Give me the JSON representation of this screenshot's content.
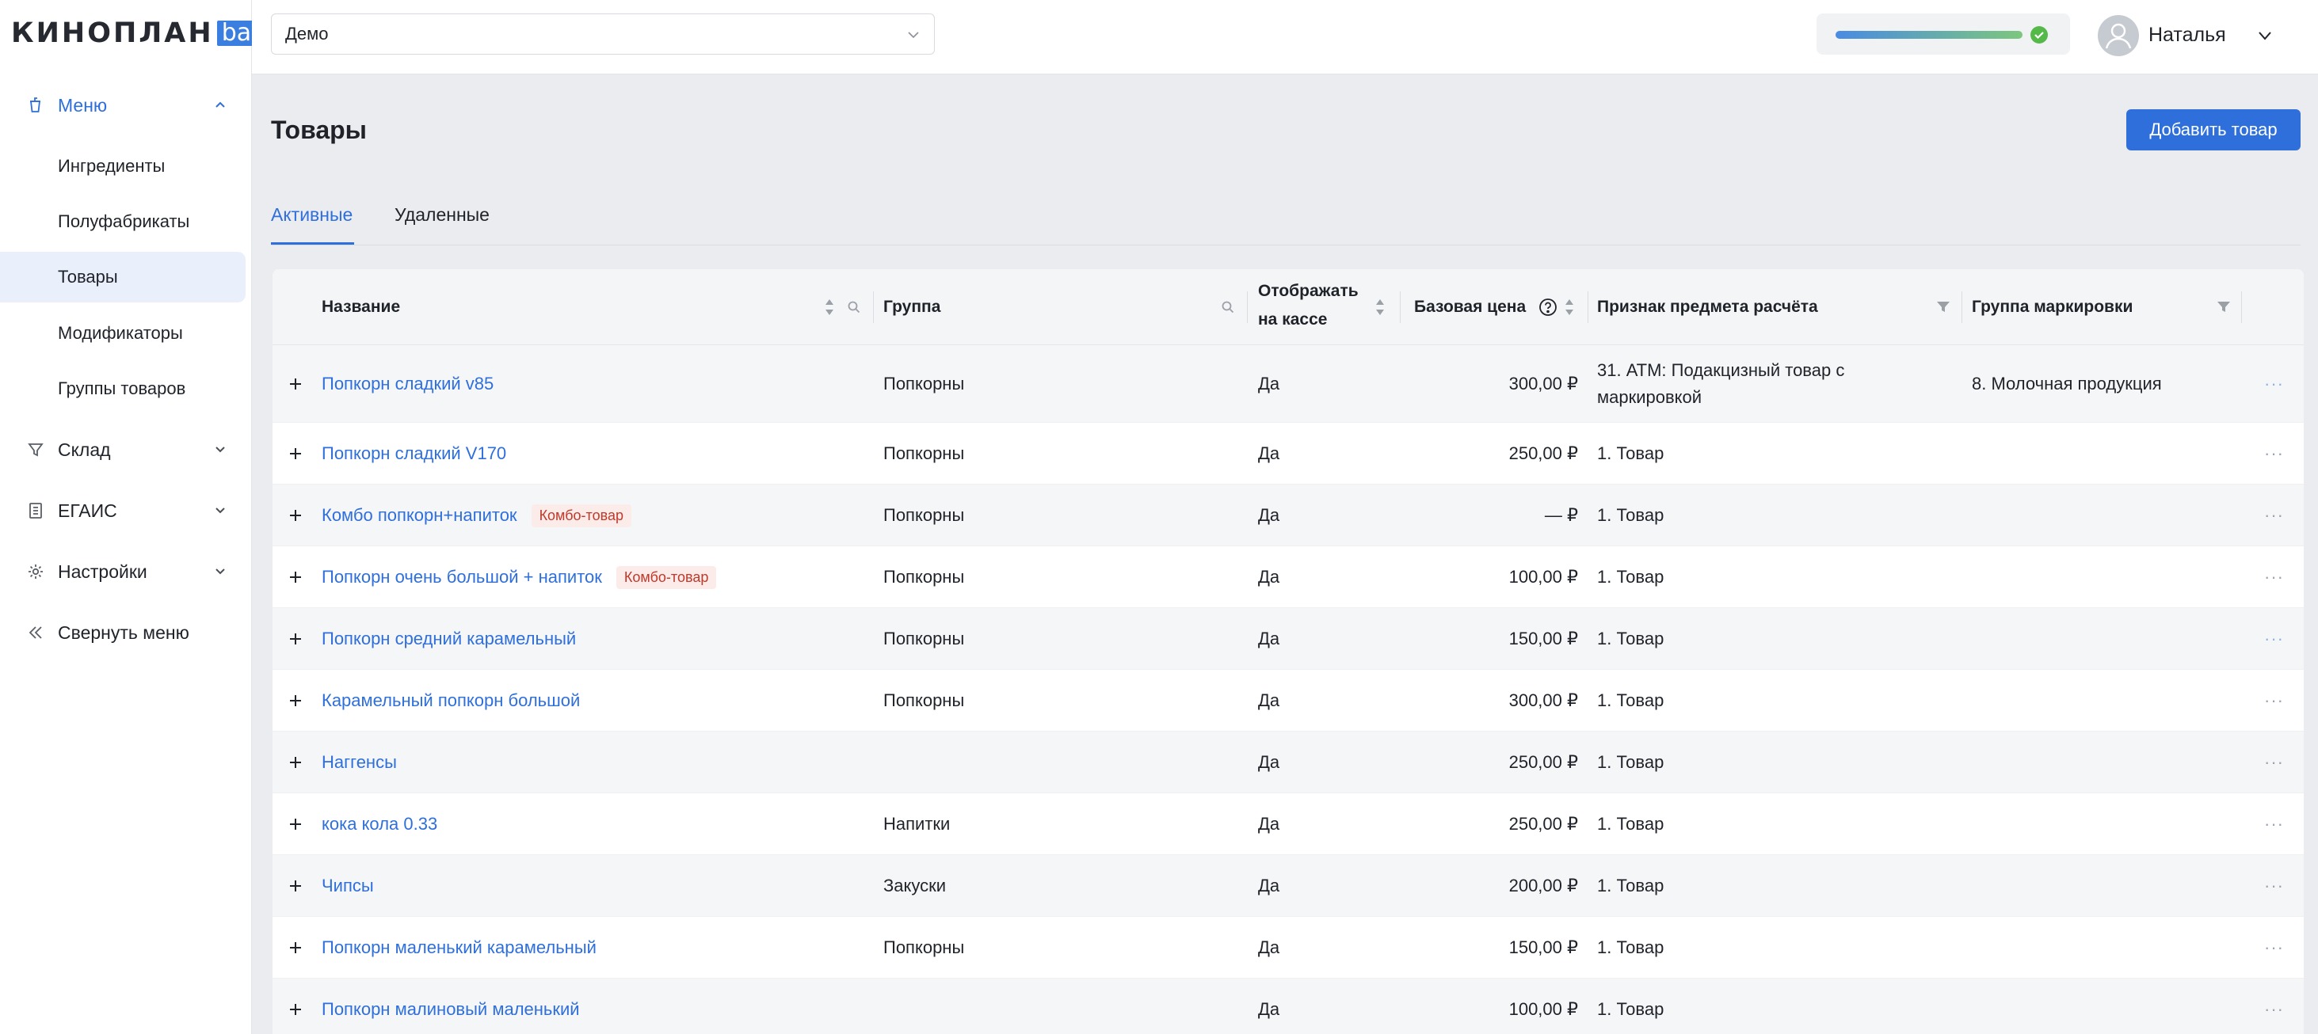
{
  "brand": {
    "logo_main": "КИНОПЛАН",
    "logo_badge": "bar",
    "accent": "#2f6fdb"
  },
  "sidebar": {
    "menu_label": "Меню",
    "sub_items": [
      {
        "label": "Ингредиенты"
      },
      {
        "label": "Полуфабрикаты"
      },
      {
        "label": "Товары"
      },
      {
        "label": "Модификаторы"
      },
      {
        "label": "Группы товаров"
      }
    ],
    "groups": [
      {
        "label": "Склад",
        "icon": "funnel-icon"
      },
      {
        "label": "ЕГАИС",
        "icon": "document-icon"
      },
      {
        "label": "Настройки",
        "icon": "gear-icon"
      }
    ],
    "collapse_label": "Свернуть меню"
  },
  "header": {
    "venue_select": "Демо",
    "user_name": "Наталья",
    "status_color": "#55b94a"
  },
  "page": {
    "title": "Товары",
    "add_button": "Добавить товар",
    "tabs": [
      {
        "label": "Активные"
      },
      {
        "label": "Удаленные"
      }
    ]
  },
  "table": {
    "columns": {
      "name": "Название",
      "group": "Группа",
      "show_line1": "Отображать",
      "show_line2": "на кассе",
      "price": "Базовая цена",
      "sign": "Признак предмета расчёта",
      "marking": "Группа маркировки"
    },
    "rows": [
      {
        "name": "Попкорн сладкий v85",
        "badge": "",
        "group": "Попкорны",
        "show": "Да",
        "price": "300,00 ₽",
        "sign_line1": "31. АТМ: Подакцизный товар с",
        "sign_line2": "маркировкой",
        "marking": "8. Молочная продукция"
      },
      {
        "name": "Попкорн сладкий V170",
        "badge": "",
        "group": "Попкорны",
        "show": "Да",
        "price": "250,00 ₽",
        "sign": "1. Товар",
        "marking": ""
      },
      {
        "name": "Комбо попкорн+напиток",
        "badge": "Комбо-товар",
        "group": "Попкорны",
        "show": "Да",
        "price": "— ₽",
        "sign": "1. Товар",
        "marking": ""
      },
      {
        "name": "Попкорн очень большой + напиток",
        "badge": "Комбо-товар",
        "group": "Попкорны",
        "show": "Да",
        "price": "100,00 ₽",
        "sign": "1. Товар",
        "marking": ""
      },
      {
        "name": "Попкорн средний карамельный",
        "badge": "",
        "group": "Попкорны",
        "show": "Да",
        "price": "150,00 ₽",
        "sign": "1. Товар",
        "marking": ""
      },
      {
        "name": "Карамельный попкорн большой",
        "badge": "",
        "group": "Попкорны",
        "show": "Да",
        "price": "300,00 ₽",
        "sign": "1. Товар",
        "marking": ""
      },
      {
        "name": "Наггенсы",
        "badge": "",
        "group": "",
        "show": "Да",
        "price": "250,00 ₽",
        "sign": "1. Товар",
        "marking": ""
      },
      {
        "name": "кока кола 0.33",
        "badge": "",
        "group": "Напитки",
        "show": "Да",
        "price": "250,00 ₽",
        "sign": "1. Товар",
        "marking": ""
      },
      {
        "name": "Чипсы",
        "badge": "",
        "group": "Закуски",
        "show": "Да",
        "price": "200,00 ₽",
        "sign": "1. Товар",
        "marking": ""
      },
      {
        "name": "Попкорн маленький карамельный",
        "badge": "",
        "group": "Попкорны",
        "show": "Да",
        "price": "150,00 ₽",
        "sign": "1. Товар",
        "marking": ""
      },
      {
        "name": "Попкорн малиновый маленький",
        "badge": "",
        "group": "",
        "show": "Да",
        "price": "100,00 ₽",
        "sign": "1. Товар",
        "marking": ""
      }
    ]
  }
}
